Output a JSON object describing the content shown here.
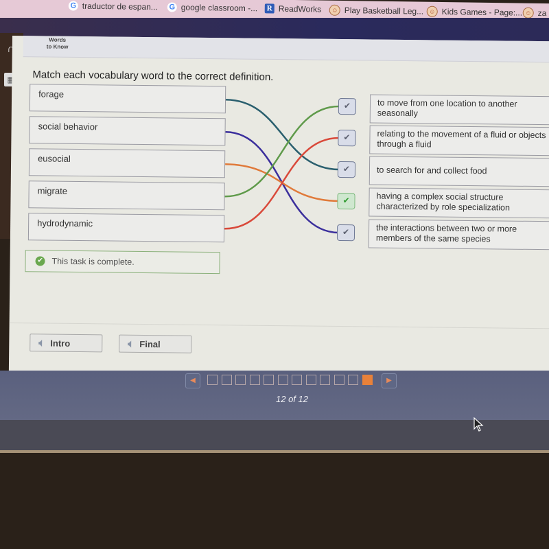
{
  "bookmarks": [
    {
      "icon": "google-icon",
      "label": "traductor de espan..."
    },
    {
      "icon": "google-icon",
      "label": "google classroom -..."
    },
    {
      "icon": "readworks-icon",
      "label": "ReadWorks"
    },
    {
      "icon": "face-icon",
      "label": "Play Basketball Leg..."
    },
    {
      "icon": "face-icon",
      "label": "Kids Games - Page:..."
    },
    {
      "icon": "face-icon",
      "label": "za"
    }
  ],
  "header": {
    "words_to_know_line1": "Words",
    "words_to_know_line2": "to Know"
  },
  "activity": {
    "instructions": "Match each vocabulary word to the correct definition.",
    "words": [
      {
        "label": "forage",
        "line_color": "#2a5f6e",
        "matched_definition": 2
      },
      {
        "label": "social behavior",
        "line_color": "#3b2f9c",
        "matched_definition": 4
      },
      {
        "label": "eusocial",
        "line_color": "#e07a3a",
        "matched_definition": 3
      },
      {
        "label": "migrate",
        "line_color": "#5f9a4a",
        "matched_definition": 0
      },
      {
        "label": "hydrodynamic",
        "line_color": "#d9493a",
        "matched_definition": 1
      }
    ],
    "definitions": [
      {
        "label": "to move from one location to another seasonally",
        "status": "checked"
      },
      {
        "label": "relating to the movement of a fluid or objects through a fluid",
        "status": "checked"
      },
      {
        "label": "to search for and collect food",
        "status": "checked"
      },
      {
        "label": "having a complex social structure characterized by role specialization",
        "status": "correct"
      },
      {
        "label": "the interactions between two or more members of the same species",
        "status": "checked"
      }
    ],
    "check_glyph": "✔",
    "complete_message": "This task is complete."
  },
  "footer": {
    "intro_label": "Intro",
    "final_label": "Final"
  },
  "navigation": {
    "total_pages": 12,
    "current_page": 12,
    "page_label": "12 of 12",
    "prev_glyph": "◀",
    "next_glyph": "▶"
  },
  "colors": {
    "accent_orange": "#e8813a",
    "correct_green": "#6aa84f"
  }
}
